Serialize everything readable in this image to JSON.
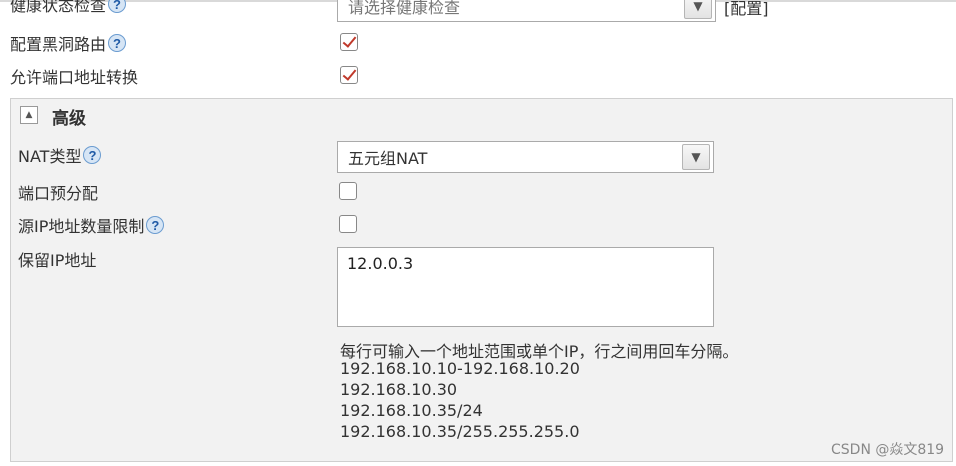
{
  "rows": {
    "health_check": {
      "label": "健康状态检查",
      "placeholder": "请选择健康检查",
      "config_link": "[配置]"
    },
    "blackhole": {
      "label": "配置黑洞路由",
      "checked": true
    },
    "port_nat": {
      "label": "允许端口地址转换",
      "checked": true
    }
  },
  "advanced": {
    "title": "高级",
    "expanded": true,
    "nat_type": {
      "label": "NAT类型",
      "value": "五元组NAT"
    },
    "port_prealloc": {
      "label": "端口预分配",
      "checked": false
    },
    "src_ip_limit": {
      "label": "源IP地址数量限制",
      "checked": false
    },
    "reserved_ip": {
      "label": "保留IP地址",
      "value": "12.0.0.3",
      "hint_lines": [
        "每行可输入一个地址范围或单个IP，行之间用回车分隔。",
        "192.168.10.10-192.168.10.20",
        "192.168.10.30",
        "192.168.10.35/24",
        "192.168.10.35/255.255.255.0"
      ]
    }
  },
  "icons": {
    "help": "?",
    "help_icon": "question-circle-icon",
    "dropdown": "chevron-down-icon",
    "collapse": "triangle-up-icon"
  },
  "colors": {
    "check": "#c0392b",
    "help_blue": "#1f5aa6",
    "panel_bg": "#f2f2f2"
  },
  "watermark": "CSDN @焱文819"
}
